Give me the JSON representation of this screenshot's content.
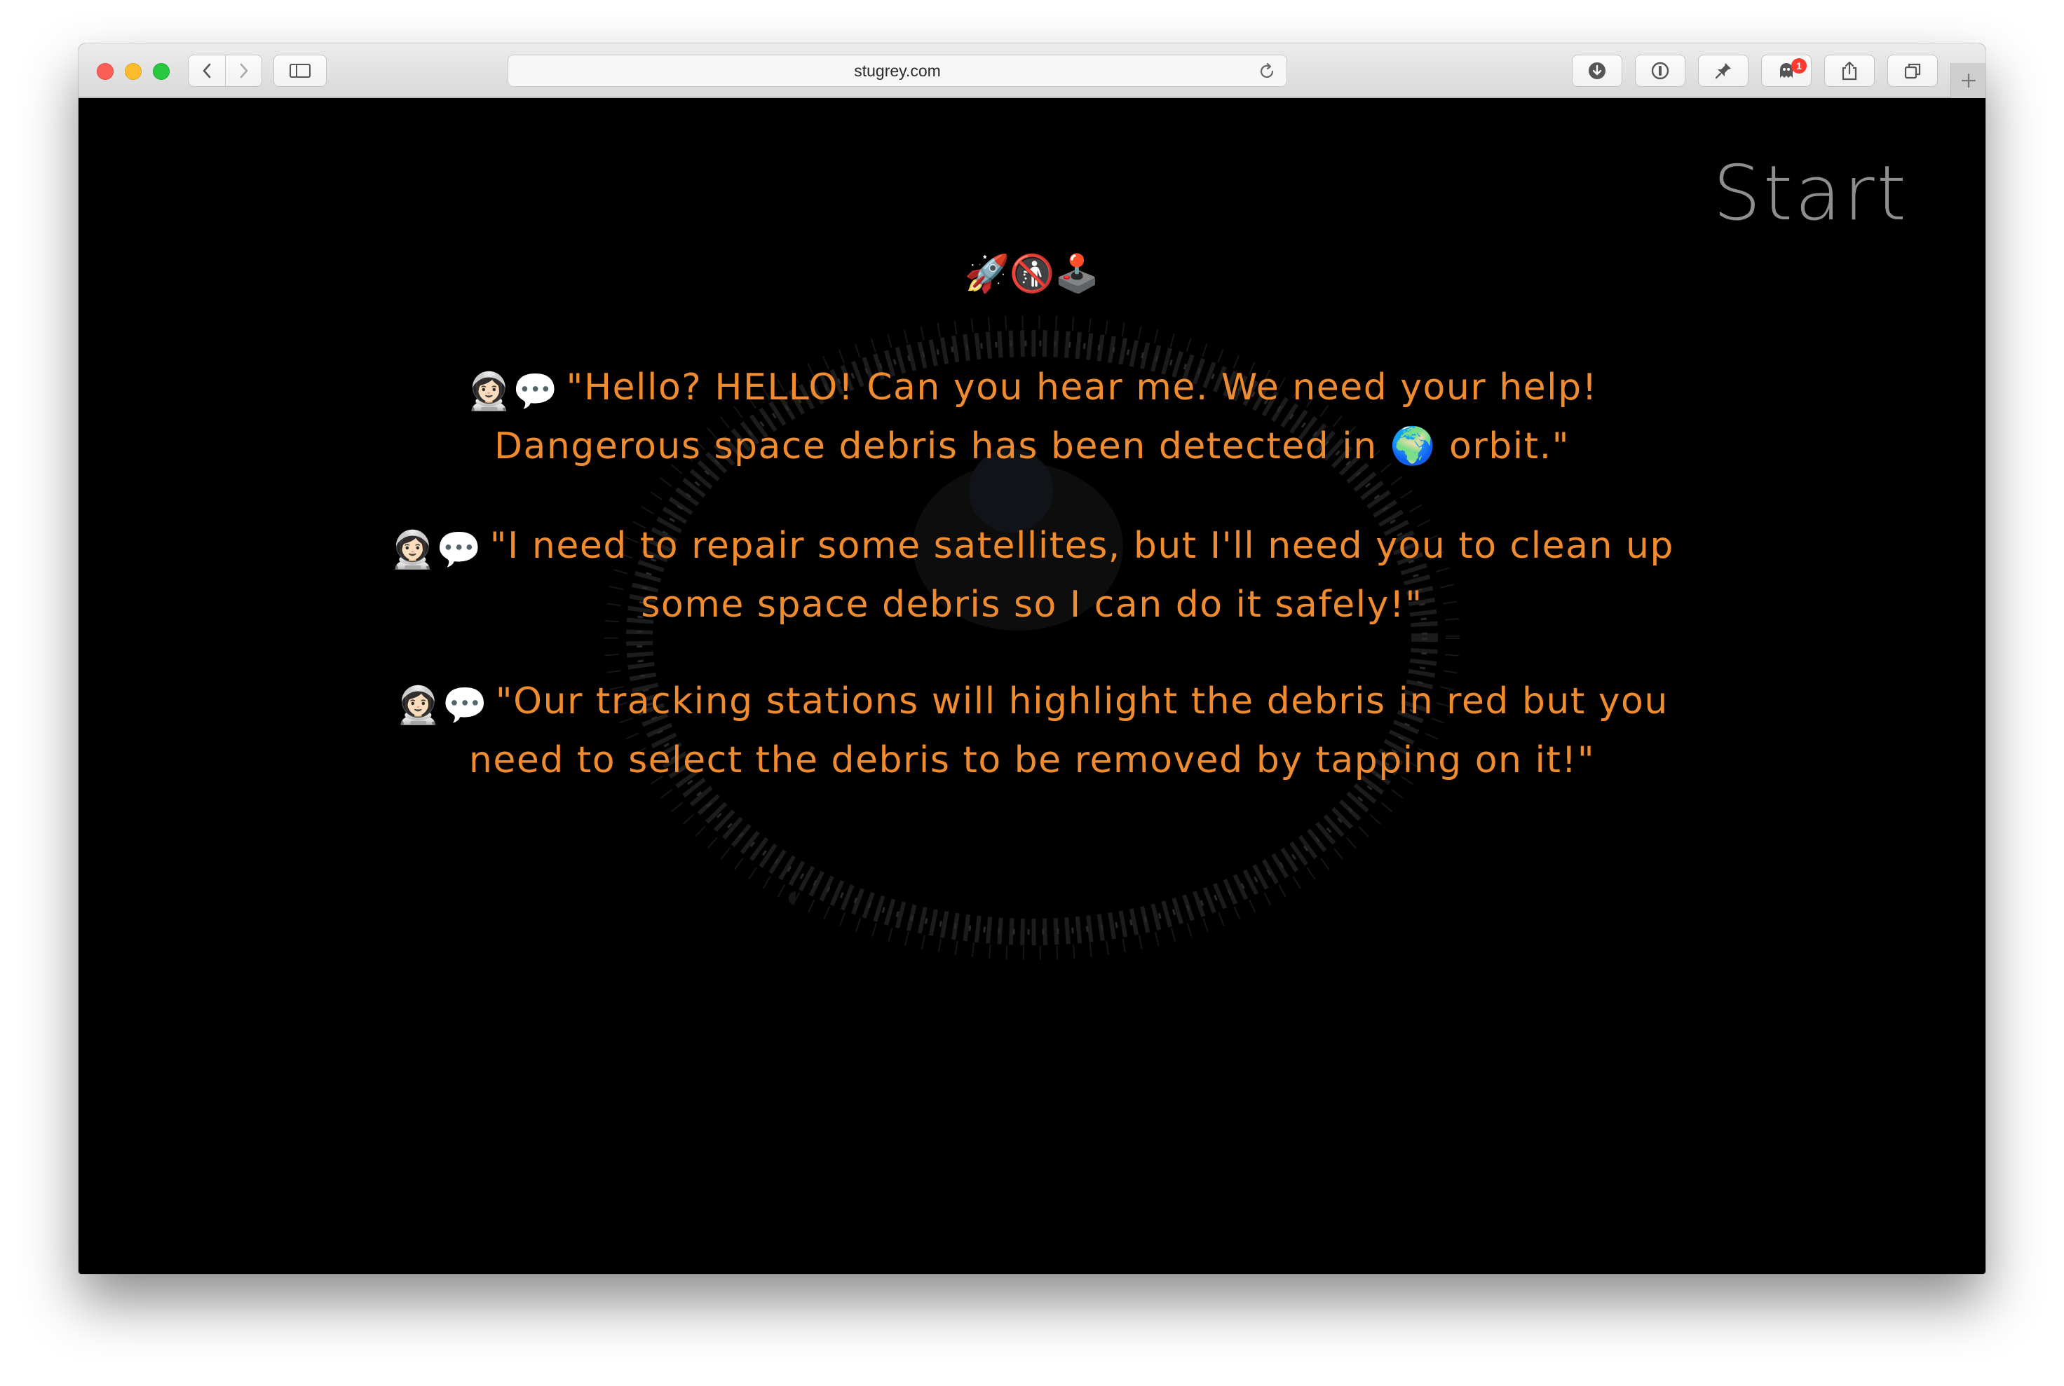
{
  "browser": {
    "url": "stugrey.com",
    "notification_count": "1"
  },
  "page": {
    "start_label": "Start",
    "title_emoji": [
      "🚀",
      "🚯",
      "🕹️"
    ],
    "speaker_emoji": "👩🏻‍🚀💬",
    "dialogue": [
      {
        "before": "\"Hello? HELLO! Can you hear me. We need your help! Dangerous space debris has been detected in ",
        "inline_emoji": "🌍",
        "after": " orbit.\""
      },
      {
        "before": "\"I need to repair some satellites, but I'll need you to clean up some space debris so I can do it safely!\"",
        "inline_emoji": "",
        "after": ""
      },
      {
        "before": "\"Our tracking stations will highlight the debris in red but you need to select the debris to be removed by tapping on it!\"",
        "inline_emoji": "",
        "after": ""
      }
    ]
  },
  "colors": {
    "dialogue_text": "#f08c2e",
    "start_text": "#8e8e8e",
    "background": "#000000"
  }
}
